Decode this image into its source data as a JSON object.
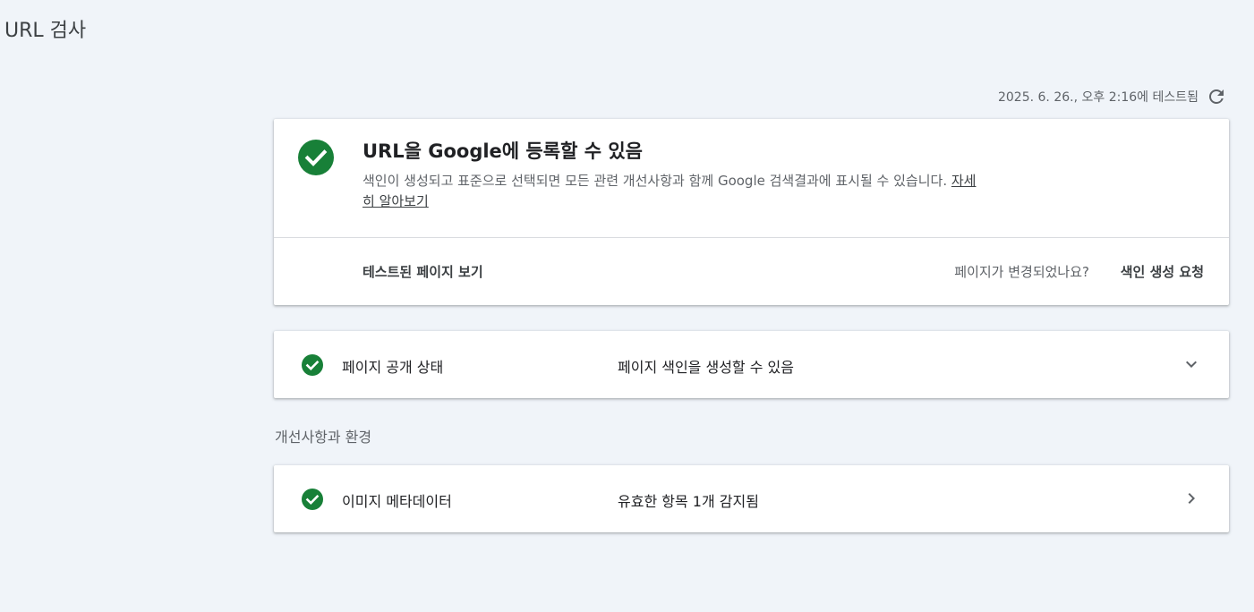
{
  "page": {
    "title": "URL 검사"
  },
  "tested": {
    "timestamp": "2025. 6. 26., 오후 2:16에 테스트됨"
  },
  "main_card": {
    "heading": "URL을 Google에 등록할 수 있음",
    "description": "색인이 생성되고 표준으로 선택되면 모든 관련 개선사항과 함께 Google 검색결과에 표시될 수 있습니다.",
    "learn_more": "자세히 알아보기",
    "view_tested_page": "테스트된 페이지 보기",
    "changed_question": "페이지가 변경되었나요?",
    "request_indexing": "색인 생성 요청"
  },
  "page_availability": {
    "label": "페이지 공개 상태",
    "value": "페이지 색인을 생성할 수 있음"
  },
  "enhancements": {
    "section_title": "개선사항과 환경",
    "items": [
      {
        "label": "이미지 메타데이터",
        "value": "유효한 항목 1개 감지됨"
      }
    ]
  },
  "colors": {
    "success": "#188038",
    "text_primary": "#202124",
    "text_secondary": "#5f6368",
    "background": "#f0f4f9"
  },
  "icons": {
    "status": "check-circle-icon",
    "refresh": "refresh-icon",
    "expand": "chevron-down-icon",
    "navigate": "chevron-right-icon"
  }
}
